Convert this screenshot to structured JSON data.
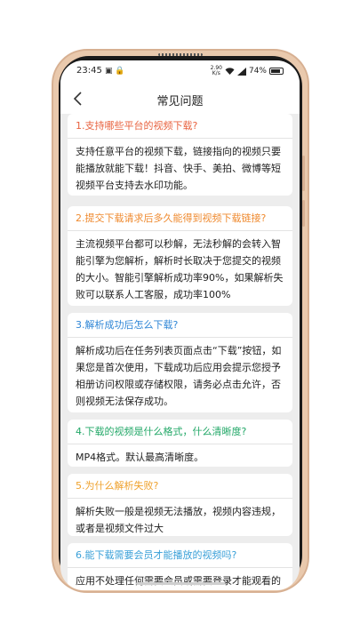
{
  "status_bar": {
    "time": "23:45",
    "left_icons": "▣ 🔒",
    "net_speed_top": "2.90",
    "net_speed_bottom": "K/s",
    "signal": "📶",
    "battery_text": "74%"
  },
  "header": {
    "title": "常见问题"
  },
  "faq": [
    {
      "question": "1.支持哪些平台的视频下载?",
      "answer": "支持任意平台的视频下载，链接指向的视频只要能播放就能下载！抖音、快手、美拍、微博等短视频平台支持去水印功能。",
      "color": "#e8623f"
    },
    {
      "question": "2.提交下载请求后多久能得到视频下载链接?",
      "answer": "主流视频平台都可以秒解，无法秒解的会转入智能引擎为您解析，解析时长取决于您提交的视频的大小。智能引擎解析成功率90%，如果解析失败可以联系人工客服，成功率100%",
      "color": "#ef8a2f"
    },
    {
      "question": "3.解析成功后怎么下载?",
      "answer": "解析成功后在任务列表页面点击“下载”按钮，如果您是首次使用，下载成功后应用会提示您授予相册访问权限或存储权限，请务必点击允许，否则视频无法保存成功。",
      "color": "#2f86d6"
    },
    {
      "question": "4.下载的视频是什么格式，什么清晰度?",
      "answer": "MP4格式。默认最高清晰度。",
      "color": "#23a868"
    },
    {
      "question": "5.为什么解析失败?",
      "answer": "解析失败一般是视频无法播放，视频内容违规，或者是视频文件过大",
      "color": "#efa12c"
    },
    {
      "question": "6.能下载需要会员才能播放的视频吗?",
      "answer": "应用不处理任何需要会员或需要登录才能观看的视频",
      "color": "#3aa0d8"
    }
  ]
}
